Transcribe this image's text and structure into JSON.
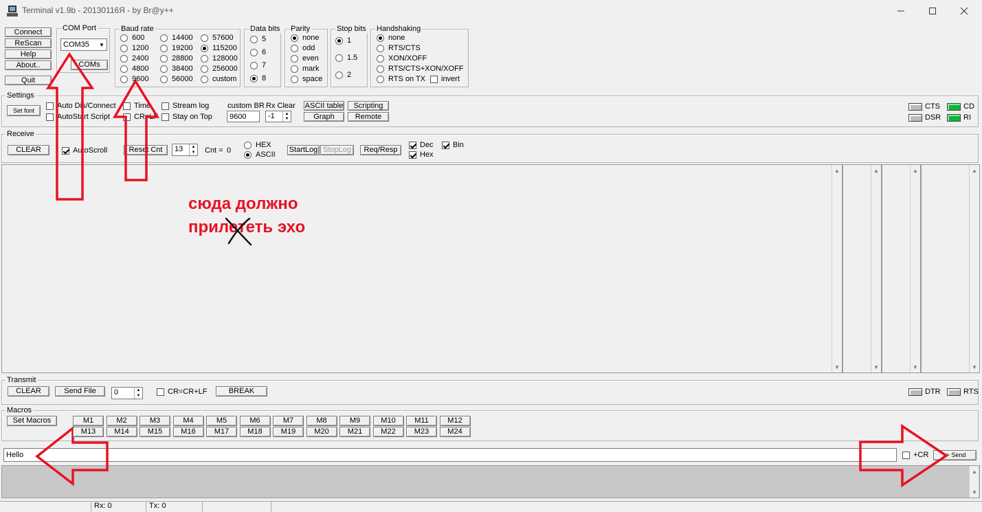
{
  "window": {
    "title": "Terminal v1.9b - 20130116Я - by Br@y++"
  },
  "colors": {
    "led_on": "#11b43b",
    "annotation": "#e81224"
  },
  "buttons": {
    "connect": "Connect",
    "rescan": "ReScan",
    "help": "Help",
    "about": "About..",
    "quit": "Quit",
    "coms": "COMs"
  },
  "com_port": {
    "label": "COM Port",
    "value": "COM35"
  },
  "baud_rate": {
    "label": "Baud rate",
    "options": [
      "600",
      "1200",
      "2400",
      "4800",
      "9600",
      "14400",
      "19200",
      "28800",
      "38400",
      "56000",
      "57600",
      "115200",
      "128000",
      "256000",
      "custom"
    ],
    "selected": "115200"
  },
  "data_bits": {
    "label": "Data bits",
    "options": [
      "5",
      "6",
      "7",
      "8"
    ],
    "selected": "8"
  },
  "parity": {
    "label": "Parity",
    "options": [
      "none",
      "odd",
      "even",
      "mark",
      "space"
    ],
    "selected": "none"
  },
  "stop_bits": {
    "label": "Stop bits",
    "options": [
      "1",
      "1.5",
      "2"
    ],
    "selected": "1"
  },
  "handshaking": {
    "label": "Handshaking",
    "options": [
      "none",
      "RTS/CTS",
      "XON/XOFF",
      "RTS/CTS+XON/XOFF",
      "RTS on TX"
    ],
    "selected": "none",
    "invert_label": "invert"
  },
  "settings": {
    "label": "Settings",
    "set_font": "Set font",
    "auto_dis_connect": "Auto Dis/Connect",
    "autostart_script": "AutoStart Script",
    "time": "Time",
    "cr_lf": "CR=LF",
    "stream_log": "Stream log",
    "stay_on_top": "Stay on Top",
    "custom_br_label": "custom BR",
    "custom_br_value": "9600",
    "rx_clear_label": "Rx Clear",
    "rx_clear_value": "-1",
    "ascii_table": "ASCII table",
    "graph": "Graph",
    "scripting": "Scripting",
    "remote": "Remote"
  },
  "leds": {
    "cts": "CTS",
    "cd": "CD",
    "dsr": "DSR",
    "ri": "RI",
    "dtr": "DTR",
    "rts": "RTS"
  },
  "receive": {
    "label": "Receive",
    "clear": "CLEAR",
    "autoscroll": "AutoScroll",
    "reset_cnt": "Reset Cnt",
    "cnt_spin": "13",
    "cnt_label": "Cnt =",
    "cnt_value": "0",
    "hex": "HEX",
    "ascii": "ASCII",
    "startlog": "StartLog",
    "stoplog": "StopLog",
    "req_resp": "Req/Resp",
    "dec": "Dec",
    "hex_chk": "Hex",
    "bin": "Bin"
  },
  "annotation": {
    "line1": "сюда должно",
    "line2": "прилететь эхо"
  },
  "transmit": {
    "label": "Transmit",
    "clear": "CLEAR",
    "send_file": "Send File",
    "spin_value": "0",
    "cr_crlf": "CR=CR+LF",
    "break": "BREAK"
  },
  "macros": {
    "label": "Macros",
    "set_macros": "Set Macros",
    "row1": [
      "M1",
      "M2",
      "M3",
      "M4",
      "M5",
      "M6",
      "M7",
      "M8",
      "M9",
      "M10",
      "M11",
      "M12"
    ],
    "row2": [
      "M13",
      "M14",
      "M15",
      "M16",
      "M17",
      "M18",
      "M19",
      "M20",
      "M21",
      "M22",
      "M23",
      "M24"
    ]
  },
  "send": {
    "input_value": "Hello",
    "plus_cr": "+CR",
    "send_label": "-> Send"
  },
  "status": {
    "rx": "Rx: 0",
    "tx": "Tx: 0"
  }
}
